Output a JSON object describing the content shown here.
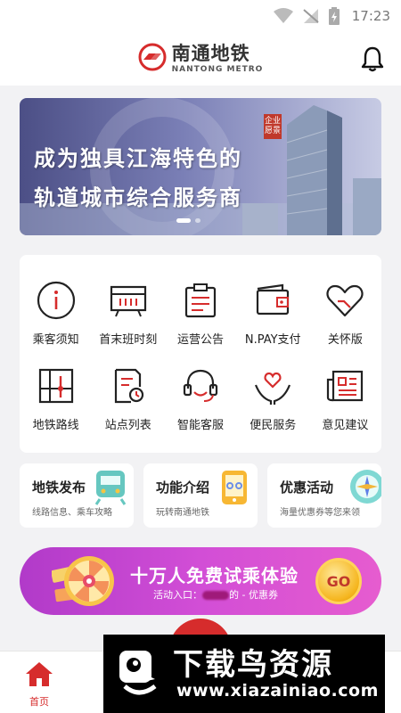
{
  "status_bar": {
    "time": "17:23"
  },
  "header": {
    "brand_cn": "南通地铁",
    "brand_en": "NANTONG METRO"
  },
  "banner": {
    "line1": "成为独具江海特色的",
    "line2": "轨道城市综合服务商",
    "tag": "企业愿景"
  },
  "services": [
    {
      "label": "乘客须知",
      "icon": "info-icon"
    },
    {
      "label": "首末班时刻",
      "icon": "timetable-icon"
    },
    {
      "label": "运营公告",
      "icon": "notice-icon"
    },
    {
      "label": "N.PAY支付",
      "icon": "wallet-icon"
    },
    {
      "label": "关怀版",
      "icon": "heart-icon"
    },
    {
      "label": "地铁路线",
      "icon": "route-map-icon"
    },
    {
      "label": "站点列表",
      "icon": "station-list-icon"
    },
    {
      "label": "智能客服",
      "icon": "headset-icon"
    },
    {
      "label": "便民服务",
      "icon": "hands-heart-icon"
    },
    {
      "label": "意见建议",
      "icon": "newspaper-icon"
    }
  ],
  "features": [
    {
      "title": "地铁发布",
      "subtitle": "线路信息、乘车攻略",
      "icon": "train-icon"
    },
    {
      "title": "功能介绍",
      "subtitle": "玩转南通地铁",
      "icon": "phone-icon"
    },
    {
      "title": "优惠活动",
      "subtitle": "海量优惠券等您来领",
      "icon": "compass-icon"
    }
  ],
  "promo": {
    "title": "十万人免费试乘体验",
    "sub_prefix": "活动入口：",
    "sub_suffix": "的 - 优惠券",
    "button": "GO"
  },
  "tabbar": {
    "home_label": "首页"
  },
  "watermark": {
    "title": "下载鸟资源",
    "url": "www.xiazainiao.com"
  },
  "colors": {
    "accent": "#d62c2c",
    "promo": "#c94bd0",
    "banner": "#5b5f9a"
  }
}
